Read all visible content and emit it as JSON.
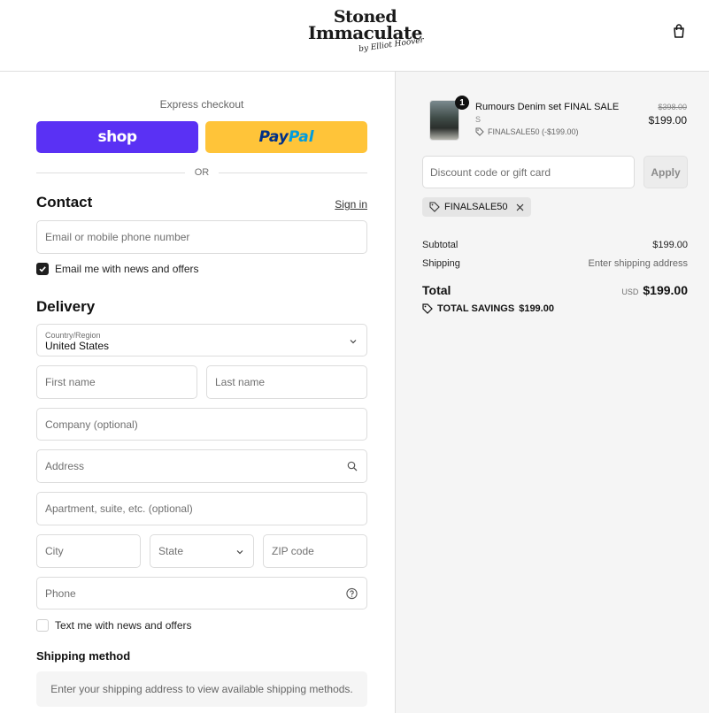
{
  "header": {
    "logo_line1": "Stoned",
    "logo_line2": "Immaculate",
    "logo_signature": "by Elliot Hoover"
  },
  "express": {
    "label": "Express checkout",
    "shop_label": "shop",
    "paypal_label_part1": "Pay",
    "paypal_label_part2": "Pal",
    "or_label": "OR"
  },
  "contact": {
    "title": "Contact",
    "signin_label": "Sign in",
    "email_placeholder": "Email or mobile phone number",
    "email_news_label": "Email me with news and offers",
    "email_news_checked": true
  },
  "delivery": {
    "title": "Delivery",
    "country_label": "Country/Region",
    "country_value": "United States",
    "first_name_placeholder": "First name",
    "last_name_placeholder": "Last name",
    "company_placeholder": "Company (optional)",
    "address_placeholder": "Address",
    "apartment_placeholder": "Apartment, suite, etc. (optional)",
    "city_placeholder": "City",
    "state_placeholder": "State",
    "zip_placeholder": "ZIP code",
    "phone_placeholder": "Phone",
    "text_news_label": "Text me with news and offers",
    "text_news_checked": false
  },
  "shipping_method": {
    "title": "Shipping method",
    "message": "Enter your shipping address to view available shipping methods."
  },
  "summary": {
    "item": {
      "quantity": "1",
      "title": "Rumours Denim set FINAL SALE",
      "variant": "S",
      "discount_code": "FINALSALE50 (-$199.00)",
      "original_price": "$398.00",
      "price": "$199.00"
    },
    "discount_placeholder": "Discount code or gift card",
    "apply_label": "Apply",
    "applied_code": "FINALSALE50",
    "subtotal_label": "Subtotal",
    "subtotal_value": "$199.00",
    "shipping_label": "Shipping",
    "shipping_value": "Enter shipping address",
    "total_label": "Total",
    "total_currency": "USD",
    "total_value": "$199.00",
    "savings_label": "TOTAL SAVINGS",
    "savings_value": "$199.00"
  }
}
